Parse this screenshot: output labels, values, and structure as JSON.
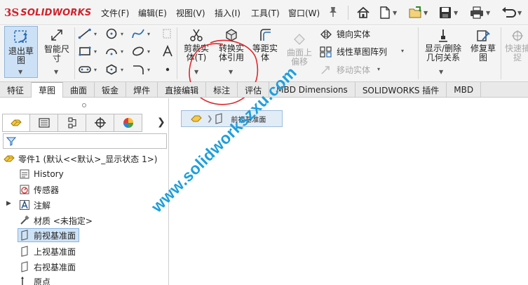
{
  "app": {
    "logo_ds": "3S",
    "logo_text": "SOLIDWORKS"
  },
  "menu": [
    {
      "label": "文件(F)"
    },
    {
      "label": "编辑(E)"
    },
    {
      "label": "视图(V)"
    },
    {
      "label": "插入(I)"
    },
    {
      "label": "工具(T)"
    },
    {
      "label": "窗口(W)"
    }
  ],
  "quick_access_icons": [
    "home-icon",
    "new-document-icon",
    "open-icon",
    "save-icon",
    "print-icon",
    "undo-icon"
  ],
  "commands": {
    "exit_sketch": "退出草\n图",
    "smart_dimension": "智能尺\n寸",
    "trim_entities": "剪裁实\n体(T)",
    "convert_entities": "转换实\n体引用",
    "offset_entities": "等距实\n体",
    "offset_on_surface": "曲面上\n偏移",
    "mirror_entities": "镜向实体",
    "linear_pattern": "线性草图阵列",
    "move_entities": "移动实体",
    "display_delete_relations": "显示/删除\n几何关系",
    "repair_sketch": "修复草\n图",
    "quick_snaps": "快速捕\n捉"
  },
  "tabs": [
    {
      "label": "特征",
      "active": false
    },
    {
      "label": "草图",
      "active": true
    },
    {
      "label": "曲面",
      "active": false
    },
    {
      "label": "钣金",
      "active": false
    },
    {
      "label": "焊件",
      "active": false
    },
    {
      "label": "直接编辑",
      "active": false
    },
    {
      "label": "标注",
      "active": false
    },
    {
      "label": "评估",
      "active": false
    },
    {
      "label": "MBD Dimensions",
      "active": false
    },
    {
      "label": "SOLIDWORKS 插件",
      "active": false
    },
    {
      "label": "MBD",
      "active": false
    }
  ],
  "tree": {
    "part": "零件1  (默认<<默认>_显示状态 1>)",
    "items": [
      {
        "label": "History"
      },
      {
        "label": "传感器"
      },
      {
        "label": "注解"
      },
      {
        "label": "材质 <未指定>"
      },
      {
        "label": "前视基准面"
      },
      {
        "label": "上视基准面"
      },
      {
        "label": "右视基准面"
      },
      {
        "label": "原点"
      }
    ]
  },
  "breadcrumb": {
    "label": "前视基准面"
  },
  "watermark": "www.solidworkszxu.com",
  "colors": {
    "brand_red": "#d4202a",
    "watermark": "#1d9fdc",
    "annotation": "#e0262a",
    "selection": "#cfe3f7"
  }
}
